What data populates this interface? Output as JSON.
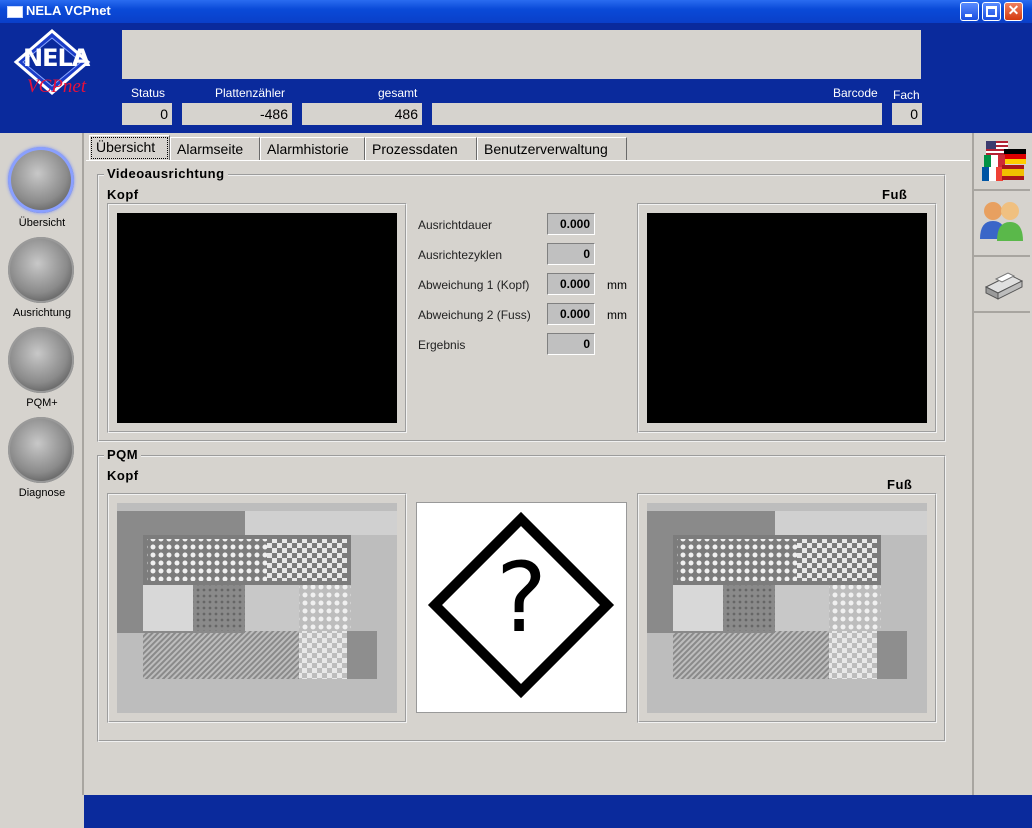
{
  "window": {
    "title": "NELA VCPnet"
  },
  "logo": {
    "brand": "NELA",
    "product": "VCPnet"
  },
  "header": {
    "status_label": "Status",
    "status_value": "0",
    "counter_label": "Plattenzähler",
    "counter_value": "-486",
    "total_label": "gesamt",
    "total_value": "486",
    "barcode_label": "Barcode",
    "barcode_value": "",
    "fach_label": "Fach",
    "fach_value": "0"
  },
  "nav": [
    {
      "label": "Übersicht"
    },
    {
      "label": "Ausrichtung"
    },
    {
      "label": "PQM+"
    },
    {
      "label": "Diagnose"
    }
  ],
  "tabs": [
    {
      "label": "Übersicht"
    },
    {
      "label": "Alarmseite"
    },
    {
      "label": "Alarmhistorie"
    },
    {
      "label": "Prozessdaten"
    },
    {
      "label": "Benutzerverwaltung"
    }
  ],
  "video": {
    "title": "Videoausrichtung",
    "head_label": "Kopf",
    "foot_label": "Fuß",
    "fields": [
      {
        "label": "Ausrichtdauer",
        "value": "0.000",
        "unit": ""
      },
      {
        "label": "Ausrichtezyklen",
        "value": "0",
        "unit": ""
      },
      {
        "label": "Abweichung 1 (Kopf)",
        "value": "0.000",
        "unit": "mm"
      },
      {
        "label": "Abweichung 2 (Fuss)",
        "value": "0.000",
        "unit": "mm"
      },
      {
        "label": "Ergebnis",
        "value": "0",
        "unit": ""
      }
    ]
  },
  "pqm": {
    "title": "PQM",
    "head_label": "Kopf",
    "foot_label": "Fuß",
    "unknown_symbol": "?"
  },
  "rightbar": {
    "icons": [
      "flags-language-icon",
      "users-icon",
      "printer-icon"
    ]
  },
  "colors": {
    "header_blue": "#0a2a9c",
    "panel_gray": "#d6d3ce"
  }
}
